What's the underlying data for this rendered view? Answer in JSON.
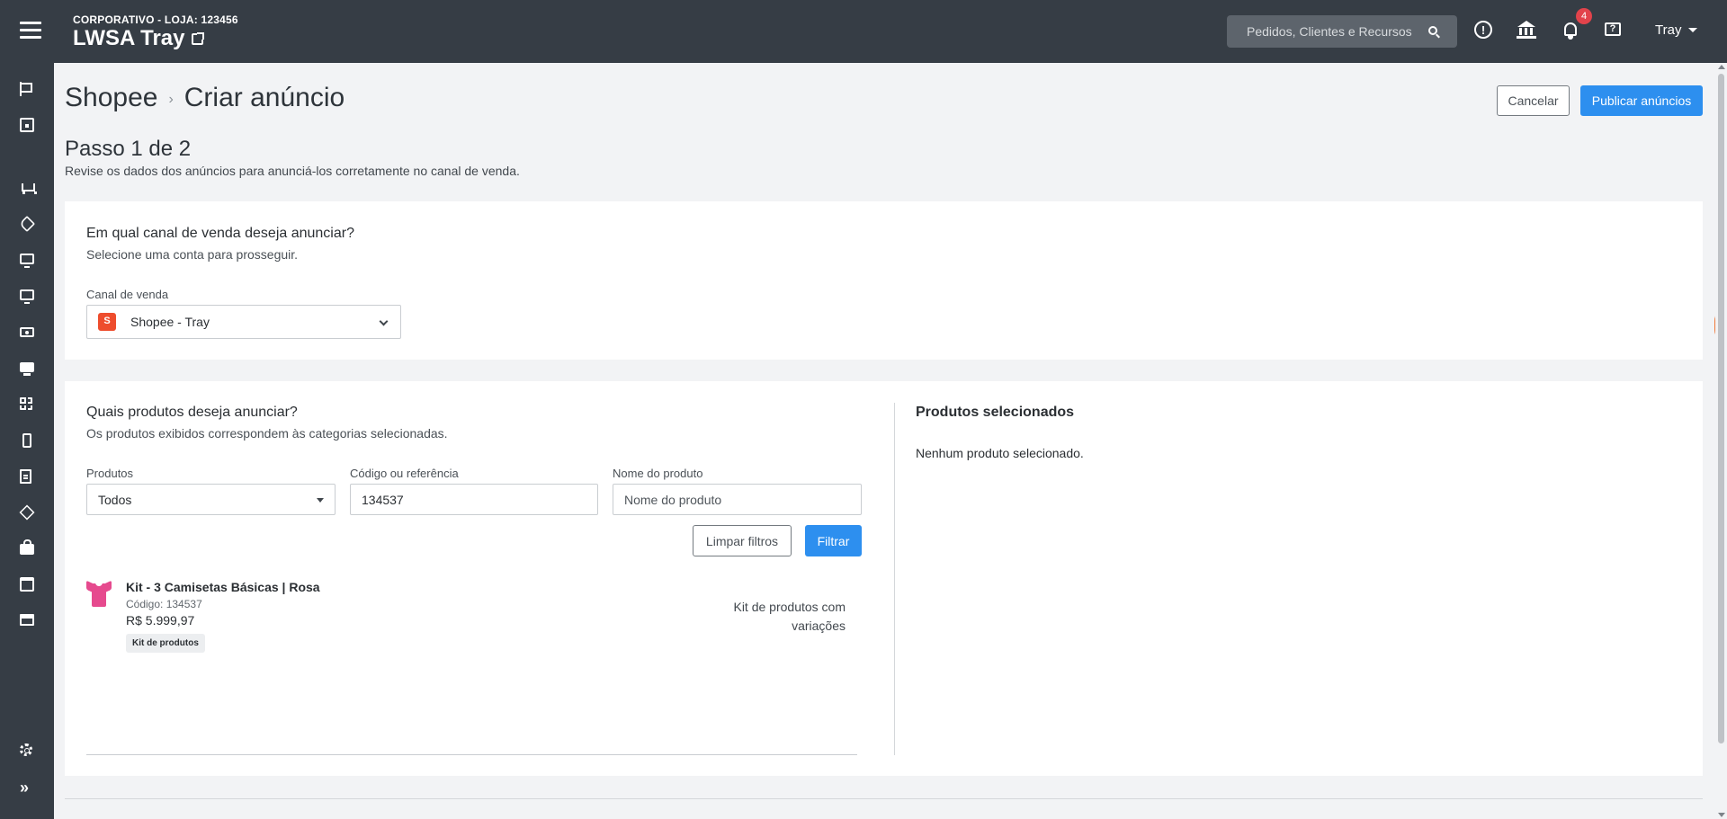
{
  "header": {
    "store_subtitle": "CORPORATIVO - LOJA: 123456",
    "store_name": "LWSA Tray",
    "search_placeholder": "Pedidos, Clientes e Recursos",
    "notifications_count": "4",
    "user_name": "Tray",
    "icons": [
      "menu-icon",
      "external-link-icon",
      "search-icon",
      "alert-icon",
      "bank-icon",
      "bell-icon",
      "feedback-icon",
      "caret-down-icon"
    ]
  },
  "sidebar": {
    "icons": [
      "flag-icon",
      "dashboard-icon",
      "cart-icon",
      "tag-icon",
      "monitor-icon",
      "display-icon",
      "money-icon",
      "pos-icon",
      "apps-icon",
      "mobile-icon",
      "document-icon",
      "box-icon",
      "bag-icon",
      "calendar-icon",
      "store-icon",
      "gear-icon",
      "expand-icon"
    ]
  },
  "page": {
    "breadcrumb_root": "Shopee",
    "breadcrumb_separator": "›",
    "breadcrumb_current": "Criar anúncio",
    "cancel_label": "Cancelar",
    "publish_label": "Publicar anúncios",
    "step_title": "Passo 1 de 2",
    "step_description": "Revise os dados dos anúncios para anunciá-los corretamente no canal de venda."
  },
  "channel_card": {
    "title": "Em qual canal de venda deseja anunciar?",
    "subtitle": "Selecione uma conta para prosseguir.",
    "field_label": "Canal de venda",
    "selected_channel": "Shopee - Tray"
  },
  "products_card": {
    "title": "Quais produtos deseja anunciar?",
    "subtitle": "Os produtos exibidos correspondem às categorias selecionadas.",
    "filters": {
      "products_label": "Produtos",
      "products_value": "Todos",
      "code_label": "Código ou referência",
      "code_value": "134537",
      "name_label": "Nome do produto",
      "name_placeholder": "Nome do produto",
      "clear_label": "Limpar filtros",
      "filter_label": "Filtrar"
    },
    "results": [
      {
        "name": "Kit - 3 Camisetas Básicas | Rosa",
        "code": "Código: 134537",
        "price": "R$ 5.999,97",
        "badge": "Kit de produtos",
        "type_line1": "Kit de produtos com",
        "type_line2": "variações"
      }
    ]
  },
  "selected_panel": {
    "title": "Produtos selecionados",
    "empty_message": "Nenhum produto selecionado."
  },
  "colors": {
    "topbar": "#363d45",
    "primary": "#2d8fef",
    "badge": "#e2434b",
    "shopee": "#ee4d2d",
    "product": "#e64a8e"
  }
}
